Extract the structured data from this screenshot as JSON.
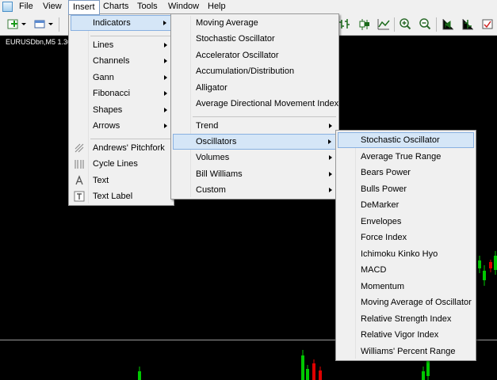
{
  "menubar": [
    "File",
    "View",
    "Insert",
    "Charts",
    "Tools",
    "Window",
    "Help"
  ],
  "chart": {
    "symbol": "EURUSDbn,M5  1.36"
  },
  "insert_menu": {
    "groups": [
      [
        "Indicators"
      ],
      [
        "Lines",
        "Channels",
        "Gann",
        "Fibonacci",
        "Shapes",
        "Arrows"
      ],
      [
        "Andrews' Pitchfork",
        "Cycle Lines",
        "Text",
        "Text Label"
      ]
    ],
    "icons": {
      "Andrews' Pitchfork": "pitchfork-icon",
      "Cycle Lines": "cycle-lines-icon",
      "Text": "text-icon",
      "Text Label": "text-label-icon"
    }
  },
  "indicators_menu": {
    "groups": [
      [
        "Moving Average",
        "Stochastic Oscillator",
        "Accelerator Oscillator",
        "Accumulation/Distribution",
        "Alligator",
        "Average Directional Movement Index"
      ],
      [
        "Trend",
        "Oscillators",
        "Volumes",
        "Bill Williams",
        "Custom"
      ]
    ]
  },
  "oscillators_menu": {
    "items": [
      "Stochastic Oscillator",
      "Average True Range",
      "Bears Power",
      "Bulls Power",
      "DeMarker",
      "Envelopes",
      "Force Index",
      "Ichimoku Kinko Hyo",
      "MACD",
      "Momentum",
      "Moving Average of Oscillator",
      "Relative Strength Index",
      "Relative Vigor Index",
      "Williams' Percent Range"
    ]
  },
  "colors": {
    "bull_candle": "#00c800",
    "bear_candle": "#e00000",
    "highlight": "#d5e6f7",
    "highlight_border": "#88b0e0",
    "chart_bg": "#000000"
  }
}
